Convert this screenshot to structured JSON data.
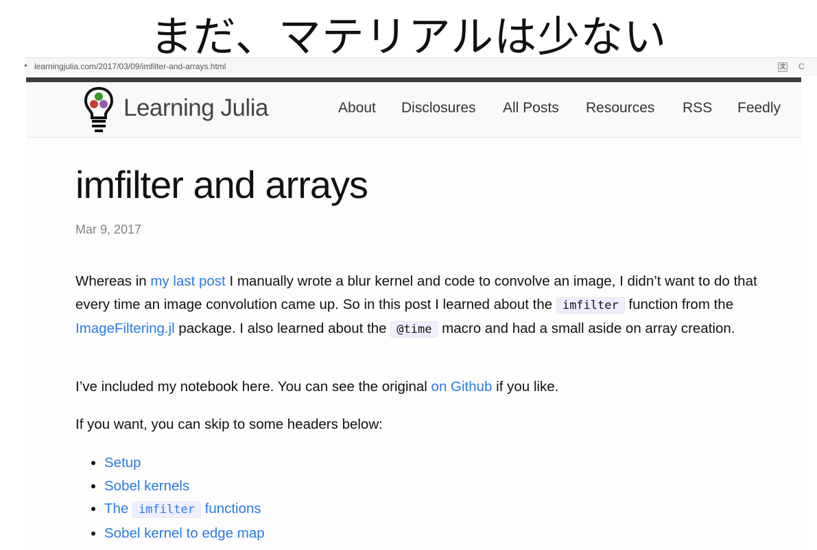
{
  "slide": {
    "title": "まだ、マテリアルは少ない"
  },
  "browser": {
    "url": "learningjulia.com/2017/03/09/imfilter-and-arrays.html",
    "translate_icon": "translate-icon",
    "menu_char": "C"
  },
  "site": {
    "title": "Learning Julia",
    "logo_icon": "lightbulb-logo-icon",
    "nav": [
      "About",
      "Disclosures",
      "All Posts",
      "Resources",
      "RSS",
      "Feedly"
    ]
  },
  "post": {
    "title": "imfilter and arrays",
    "date": "Mar 9, 2017",
    "intro": {
      "t1": "Whereas in ",
      "link1": "my last post",
      "t2": " I manually wrote a blur kernel and code to convolve an image, I didn’t want to do that every time an image convolution came up. So in this post I learned about the ",
      "code1": "imfilter",
      "t3": " function from the ",
      "link2": "ImageFiltering.jl",
      "t4": " package. I also learned about the ",
      "code2": "@time",
      "t5": " macro and had a small aside on array creation."
    },
    "notebook": {
      "t1": "I’ve included my notebook here. You can see the original ",
      "link": "on Github",
      "t2": " if you like."
    },
    "skip_text": "If you want, you can skip to some headers below:",
    "toc": {
      "setup": "Setup",
      "sobel": "Sobel kernels",
      "imfilter_pre": "The ",
      "imfilter_code": "imfilter",
      "imfilter_post": " functions",
      "edge": "Sobel kernel to edge map"
    }
  },
  "colors": {
    "link": "#2a7ae2",
    "topbar": "#3e3e3e",
    "code_bg": "#eeeeff"
  }
}
